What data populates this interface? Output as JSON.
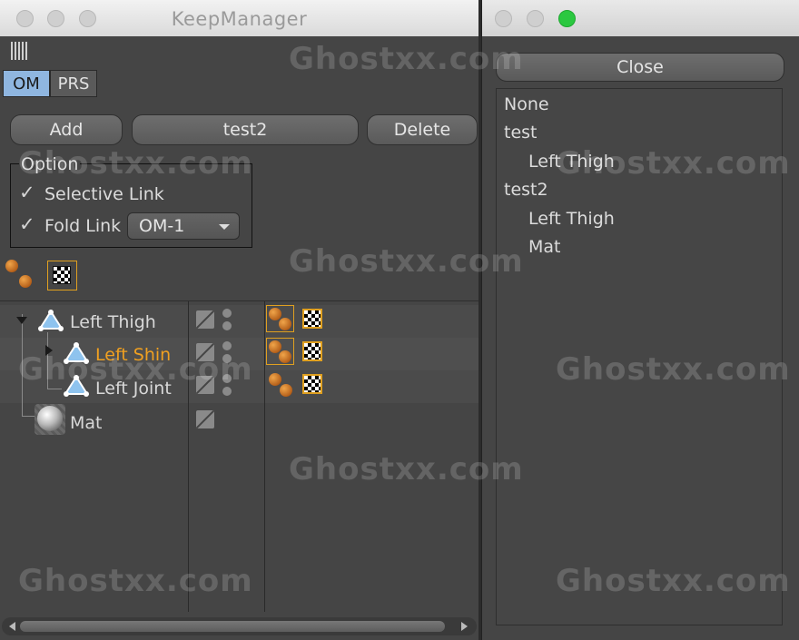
{
  "main_window": {
    "title": "KeepManager",
    "tabs": [
      "OM",
      "PRS"
    ],
    "buttons": {
      "add": "Add",
      "preset": "test2",
      "delete": "Delete"
    },
    "option": {
      "title": "Option",
      "selective_link": {
        "label": "Selective Link",
        "checked": true
      },
      "fold_link": {
        "label": "Fold Link",
        "checked": true
      },
      "dropdown_value": "OM-1"
    },
    "tree": [
      {
        "name": "Left Thigh",
        "highlighted": false
      },
      {
        "name": "Left Shin",
        "highlighted": true
      },
      {
        "name": "Left Joint",
        "highlighted": false
      },
      {
        "name": "Mat",
        "highlighted": false
      }
    ],
    "colors": {
      "highlight_text": "#f0a020",
      "tab_active": "#8fb6e0",
      "frame": "#e0a020"
    }
  },
  "side_window": {
    "close_button": "Close",
    "list": [
      {
        "label": "None",
        "indent": 0
      },
      {
        "label": "test",
        "indent": 0
      },
      {
        "label": "Left Thigh",
        "indent": 1
      },
      {
        "label": "test2",
        "indent": 0
      },
      {
        "label": "Left Thigh",
        "indent": 1
      },
      {
        "label": "Mat",
        "indent": 1
      }
    ]
  },
  "watermark": "Ghostxx.com",
  "icons": {
    "check": "✓",
    "grip": "grip-icon"
  }
}
